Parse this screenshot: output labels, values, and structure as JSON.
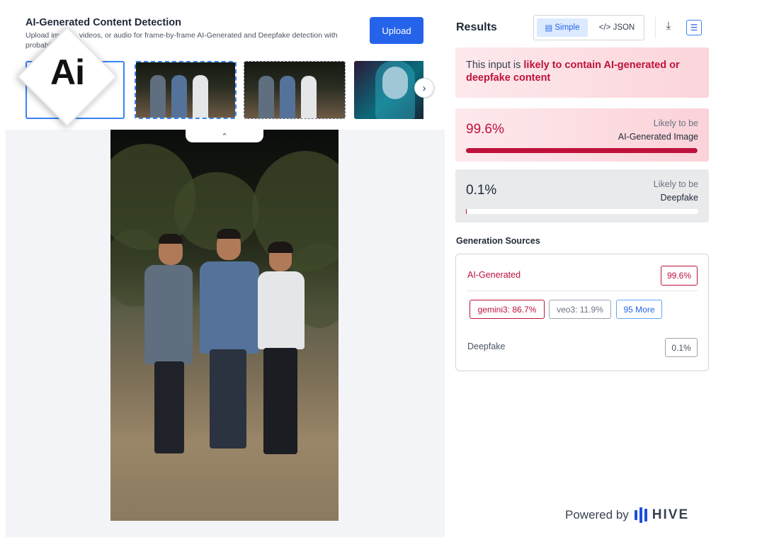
{
  "app": {
    "title": "AI-Generated Content Detection",
    "subtitle": "Upload images, videos, or audio for frame-by-frame AI-Generated and Deepfake detection with probability scores.",
    "upload_label": "Upload",
    "logo_text": "Ai"
  },
  "thumbnails": [
    {
      "kind": "empty",
      "selected": true
    },
    {
      "kind": "photo",
      "selected": false
    },
    {
      "kind": "photo",
      "selected": false
    },
    {
      "kind": "illustration",
      "selected": false
    }
  ],
  "icons": {
    "next": "chevron-right-icon",
    "collapse": "chevron-up-icon",
    "download": "download-icon",
    "layout": "layout-list-icon"
  },
  "results": {
    "title": "Results",
    "view_simple": "Simple",
    "view_json": "</> JSON",
    "active_view": "Simple",
    "verdict_prefix": "This input is ",
    "verdict_emphasis": "likely to contain AI-generated or deepfake content",
    "scores": [
      {
        "value": "99.6%",
        "likely": "Likely to be",
        "label": "AI-Generated Image",
        "fraction": 0.996
      },
      {
        "value": "0.1%",
        "likely": "Likely to be",
        "label": "Deepfake",
        "fraction": 0.001
      }
    ],
    "sources_title": "Generation Sources",
    "sources": {
      "ai_label": "AI-Generated",
      "ai_value": "99.6%",
      "chips": [
        "gemini3: 86.7%",
        "veo3: 11.9%",
        "95 More"
      ],
      "deepfake_label": "Deepfake",
      "deepfake_value": "0.1%"
    }
  },
  "footer": {
    "powered_by": "Powered by",
    "brand": "HIVE"
  },
  "colors": {
    "accent_blue": "#2563eb",
    "alert_red": "#be123c",
    "alert_bg": "#fbd5db"
  }
}
